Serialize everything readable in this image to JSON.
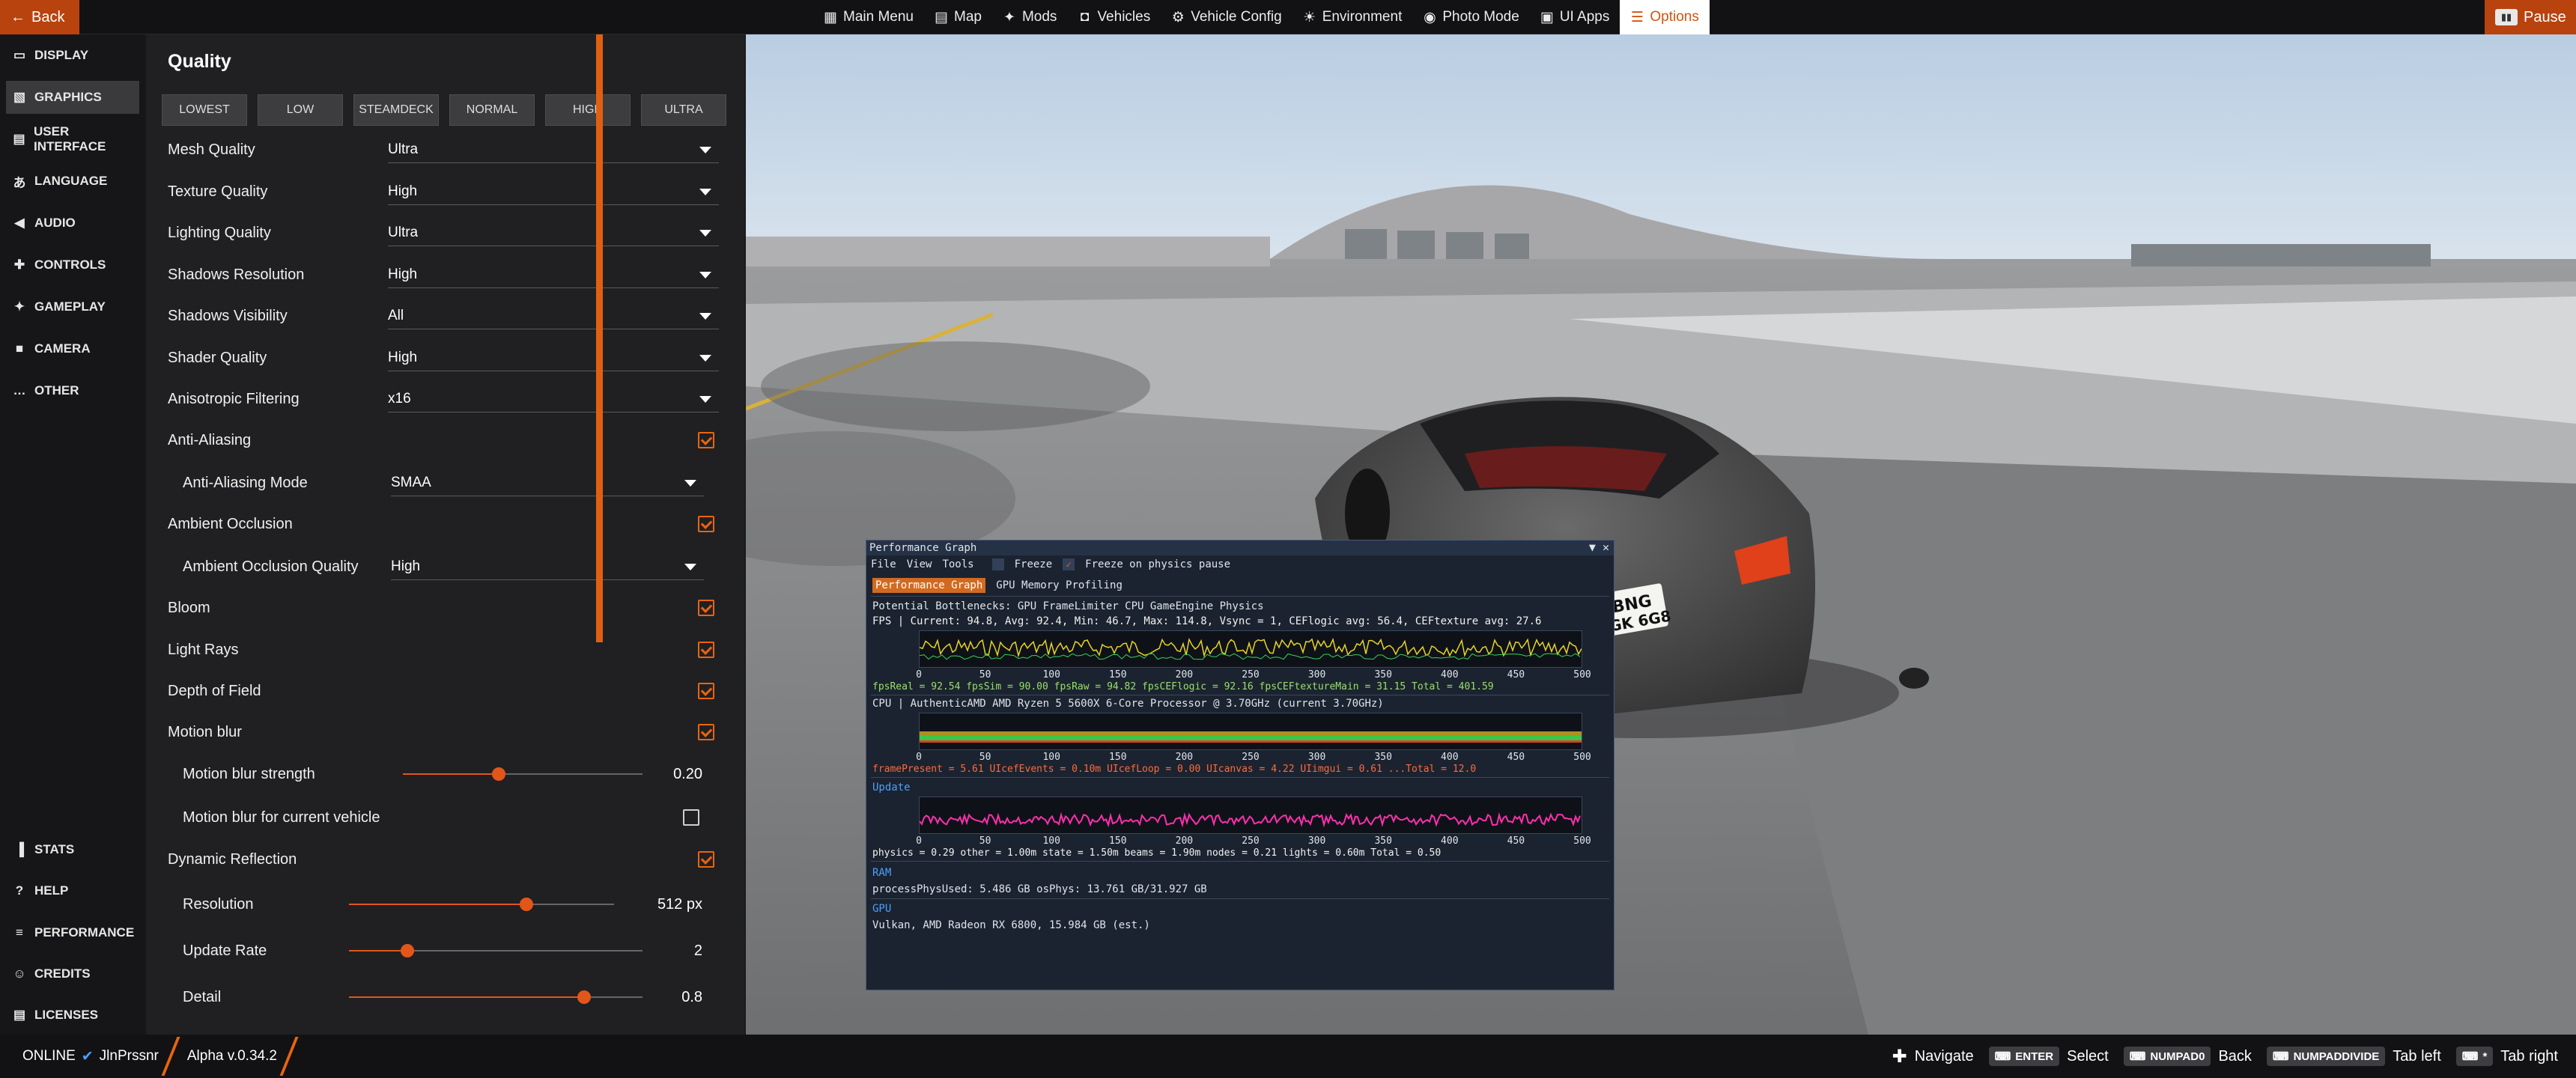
{
  "topbar": {
    "back_label": "Back",
    "pause_label": "Pause",
    "nav": [
      {
        "label": "Main Menu",
        "icon": "menu-icon",
        "active": false
      },
      {
        "label": "Map",
        "icon": "map-icon",
        "active": false
      },
      {
        "label": "Mods",
        "icon": "puzzle-icon",
        "active": false
      },
      {
        "label": "Vehicles",
        "icon": "car-icon",
        "active": false
      },
      {
        "label": "Vehicle Config",
        "icon": "car-config-icon",
        "active": false
      },
      {
        "label": "Environment",
        "icon": "sun-icon",
        "active": false
      },
      {
        "label": "Photo Mode",
        "icon": "camera-icon",
        "active": false
      },
      {
        "label": "UI Apps",
        "icon": "apps-icon",
        "active": false
      },
      {
        "label": "Options",
        "icon": "sliders-icon",
        "active": true
      }
    ]
  },
  "sidebar": {
    "items": [
      {
        "label": "DISPLAY",
        "icon": "monitor-icon"
      },
      {
        "label": "GRAPHICS",
        "icon": "image-icon",
        "active": true
      },
      {
        "label": "USER INTERFACE",
        "icon": "ui-icon"
      },
      {
        "label": "LANGUAGE",
        "icon": "translate-icon"
      },
      {
        "label": "AUDIO",
        "icon": "speaker-icon"
      },
      {
        "label": "CONTROLS",
        "icon": "gamepad-icon"
      },
      {
        "label": "GAMEPLAY",
        "icon": "puzzle-icon"
      },
      {
        "label": "CAMERA",
        "icon": "video-camera-icon"
      },
      {
        "label": "OTHER",
        "icon": "more-icon"
      }
    ],
    "bottom_items": [
      {
        "label": "STATS",
        "icon": "bar-chart-icon"
      },
      {
        "label": "HELP",
        "icon": "help-icon"
      },
      {
        "label": "PERFORMANCE",
        "icon": "performance-icon"
      },
      {
        "label": "CREDITS",
        "icon": "people-icon"
      },
      {
        "label": "LICENSES",
        "icon": "license-icon"
      }
    ]
  },
  "graphics": {
    "title": "Quality",
    "presets": [
      "LOWEST",
      "LOW",
      "STEAMDECK",
      "NORMAL",
      "HIGH",
      "ULTRA"
    ],
    "dropdowns": [
      {
        "label": "Mesh Quality",
        "value": "Ultra"
      },
      {
        "label": "Texture Quality",
        "value": "High"
      },
      {
        "label": "Lighting Quality",
        "value": "Ultra"
      },
      {
        "label": "Shadows Resolution",
        "value": "High"
      },
      {
        "label": "Shadows Visibility",
        "value": "All"
      },
      {
        "label": "Shader Quality",
        "value": "High"
      },
      {
        "label": "Anisotropic Filtering",
        "value": "x16"
      }
    ],
    "anti_aliasing": {
      "label": "Anti-Aliasing",
      "checked": true
    },
    "aa_mode": {
      "label": "Anti-Aliasing Mode",
      "value": "SMAA"
    },
    "ambient_occlusion": {
      "label": "Ambient Occlusion",
      "checked": true
    },
    "ao_quality": {
      "label": "Ambient Occlusion Quality",
      "value": "High"
    },
    "bloom": {
      "label": "Bloom",
      "checked": true
    },
    "light_rays": {
      "label": "Light Rays",
      "checked": true
    },
    "depth_of_field": {
      "label": "Depth of Field",
      "checked": true
    },
    "motion_blur": {
      "label": "Motion blur",
      "checked": true
    },
    "motion_blur_strength": {
      "label": "Motion blur strength",
      "value": "0.20",
      "fraction": 0.4
    },
    "motion_blur_vehicle": {
      "label": "Motion blur for current vehicle",
      "checked": false
    },
    "dynamic_reflection": {
      "label": "Dynamic Reflection",
      "checked": true
    },
    "resolution": {
      "label": "Resolution",
      "value": "512 px",
      "fraction": 0.67
    },
    "update_rate": {
      "label": "Update Rate",
      "value": "2",
      "fraction": 0.2
    },
    "detail": {
      "label": "Detail",
      "value": "0.8",
      "fraction": 0.8
    }
  },
  "perf_window": {
    "title": "Performance Graph",
    "menu": [
      "File",
      "View",
      "Tools"
    ],
    "freeze": "Freeze",
    "freeze_physics": "Freeze on physics pause",
    "tabs": [
      "Performance Graph",
      "GPU Memory Profiling"
    ],
    "bottlenecks": "Potential Bottlenecks:  GPU  FrameLimiter  CPU  GameEngine  Physics",
    "fps_line": "FPS | Current: 94.8, Avg: 92.4, Min: 46.7, Max: 114.8, Vsync = 1, CEFlogic avg: 56.4, CEFtexture avg: 27.6",
    "fps_legend": "fpsReal =   92.54  fpsSim =   90.00  fpsRaw =   94.82  fpsCEFlogic =   92.16  fpsCEFtextureMain =   31.15  Total = 401.59",
    "cpu_line": "CPU | AuthenticAMD AMD Ryzen 5 5600X 6-Core Processor @ 3.70GHz (current 3.70GHz)",
    "cpu_legend": "framePresent =   5.61  UIcefEvents =   0.10m UIcefLoop =   0.00  UIcanvas =   4.22  UIimgui =   0.61  ...Total = 12.0",
    "update_label": "Update",
    "update_legend": "physics =   0.29  other =   1.00m state =   1.50m beams =   1.90m nodes =   0.21  lights =   0.60m Total = 0.50",
    "ram_label": "RAM",
    "ram_line": "processPhysUsed: 5.486 GB  osPhys: 13.761 GB/31.927 GB",
    "gpu_label": "GPU",
    "gpu_line": "Vulkan, AMD Radeon RX 6800, 15.984 GB (est.)",
    "axis_ticks": [
      "0",
      "50",
      "100",
      "150",
      "200",
      "250",
      "300",
      "350",
      "400",
      "450",
      "500"
    ]
  },
  "scene": {
    "plate_line1": "BNG",
    "plate_line2": "GK 6G8"
  },
  "bottombar": {
    "online": "ONLINE",
    "user": "JlnPrssnr",
    "version": "Alpha v.0.34.2",
    "hints": [
      {
        "key": "",
        "label": "Navigate",
        "icon": "dpad-icon"
      },
      {
        "key": "ENTER",
        "label": "Select"
      },
      {
        "key": "NUMPAD0",
        "label": "Back"
      },
      {
        "key": "NUMPADDIVIDE",
        "label": "Tab left"
      },
      {
        "key": "*",
        "label": "Tab right"
      }
    ]
  },
  "colors": {
    "accent": "#e8650f",
    "panel": "#202022",
    "topbar": "#121214"
  }
}
